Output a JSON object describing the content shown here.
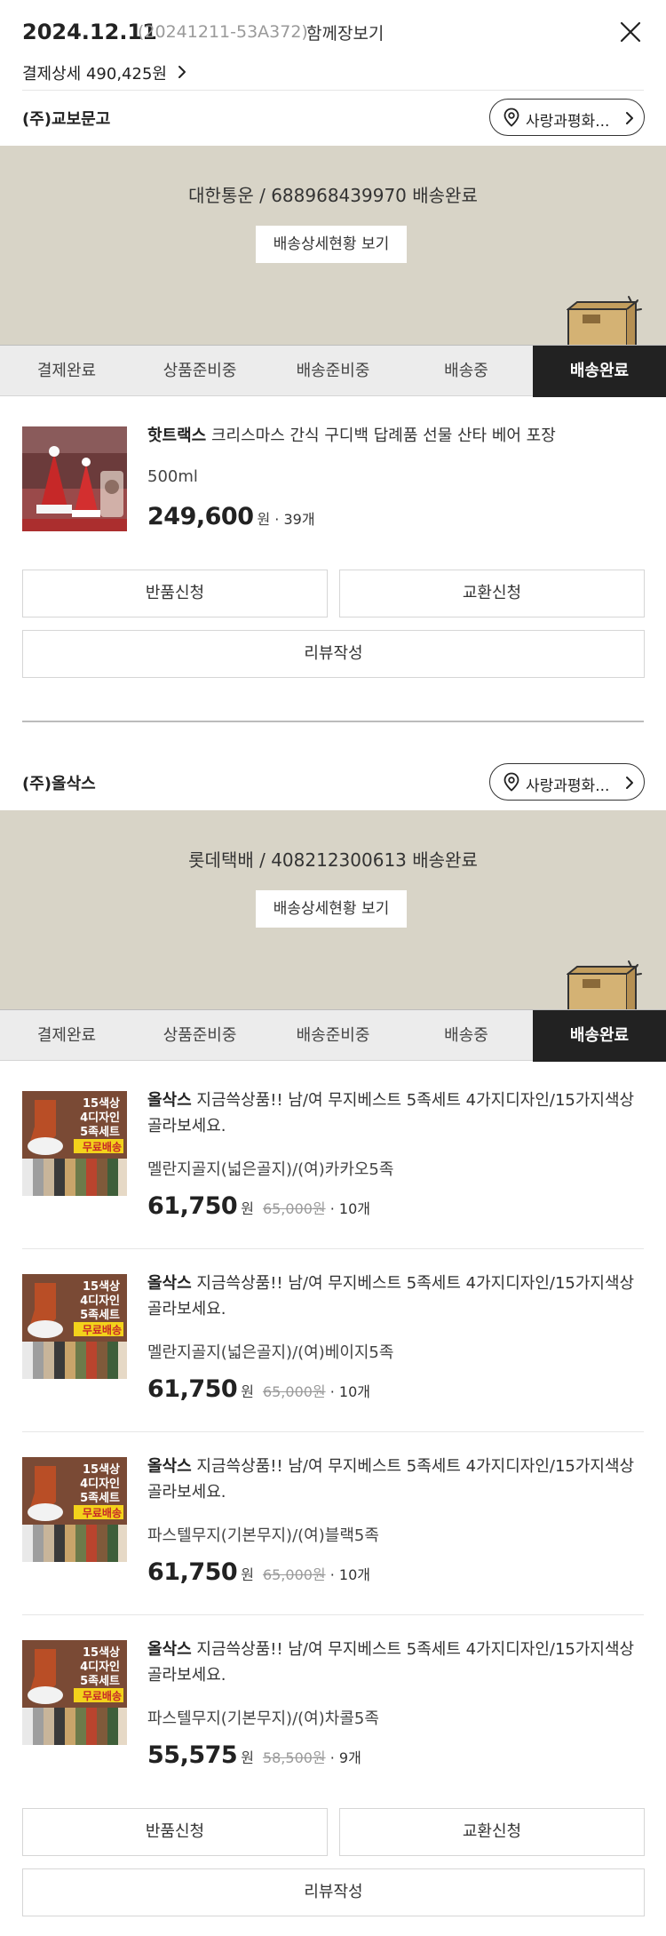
{
  "header": {
    "date": "2024.12.11",
    "order_code": "(20241211-53A372)",
    "together_label": "함께장보기",
    "payment_detail": "결제상세 490,425원",
    "close_icon": "close-icon"
  },
  "common": {
    "donate_label": "사랑과평화...",
    "detail_btn": "배송상세현황 보기",
    "return_btn": "반품신청",
    "exchange_btn": "교환신청",
    "review_btn": "리뷰작성",
    "won": "원",
    "steps": [
      "결제완료",
      "상품준비중",
      "배송준비중",
      "배송중",
      "배송완료"
    ],
    "active_step": 4
  },
  "colors": {
    "banner_bg": "#d8d4c7",
    "step_active": "#222222",
    "text": "#222222",
    "muted": "#9a9a9a"
  },
  "shipments": [
    {
      "seller": "(주)교보문고",
      "carrier_status": "대한통운 / 688968439970 배송완료",
      "products": [
        {
          "brand": "핫트랙스",
          "title": " 크리스마스 간식 구디백 답례품 선물 산타 베어 포장",
          "option": "500ml",
          "price": "249,600",
          "qty": " · 39개"
        }
      ]
    },
    {
      "seller": "(주)올삭스",
      "carrier_status": "롯데택배 / 408212300613 배송완료",
      "products": [
        {
          "brand": "올삭스",
          "title": " 지금쓱상품!! 남/여 무지베스트 5족세트 4가지디자인/15가지색상 골라보세요.",
          "option": "멜란지골지(넓은골지)/(여)카카오5족",
          "price": "61,750",
          "orig": "65,000원",
          "qty": " · 10개"
        },
        {
          "brand": "올삭스",
          "title": " 지금쓱상품!! 남/여 무지베스트 5족세트 4가지디자인/15가지색상 골라보세요.",
          "option": "멜란지골지(넓은골지)/(여)베이지5족",
          "price": "61,750",
          "orig": "65,000원",
          "qty": " · 10개"
        },
        {
          "brand": "올삭스",
          "title": " 지금쓱상품!! 남/여 무지베스트 5족세트 4가지디자인/15가지색상 골라보세요.",
          "option": "파스텔무지(기본무지)/(여)블랙5족",
          "price": "61,750",
          "orig": "65,000원",
          "qty": " · 10개"
        },
        {
          "brand": "올삭스",
          "title": " 지금쓱상품!! 남/여 무지베스트 5족세트 4가지디자인/15가지색상 골라보세요.",
          "option": "파스텔무지(기본무지)/(여)차콜5족",
          "price": "55,575",
          "orig": "58,500원",
          "qty": " · 9개"
        }
      ]
    }
  ],
  "thumb_text": {
    "line1": "15색상",
    "line2": "4디자인",
    "line3": "5족세트",
    "line4": "무료배송"
  }
}
